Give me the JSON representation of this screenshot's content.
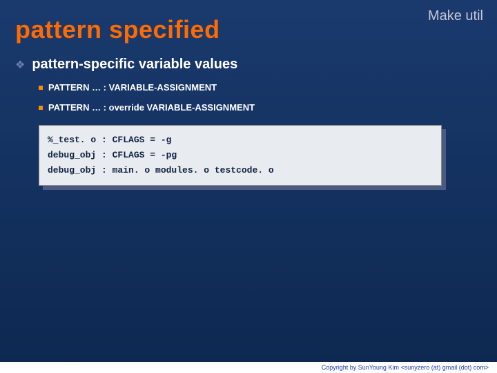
{
  "header": {
    "label": "Make util"
  },
  "title": "pattern specified",
  "sub_title": "pattern-specific variable values",
  "items": [
    "PATTERN … : VARIABLE-ASSIGNMENT",
    "PATTERN … : override VARIABLE-ASSIGNMENT"
  ],
  "code": {
    "line1": "%_test. o : CFLAGS = -g",
    "line2": "debug_obj : CFLAGS = -pg",
    "line3": "debug_obj : main. o modules. o testcode. o"
  },
  "footer": "Copyright by SunYoung Kim <sunyzero (at) gmail (dot) com>"
}
